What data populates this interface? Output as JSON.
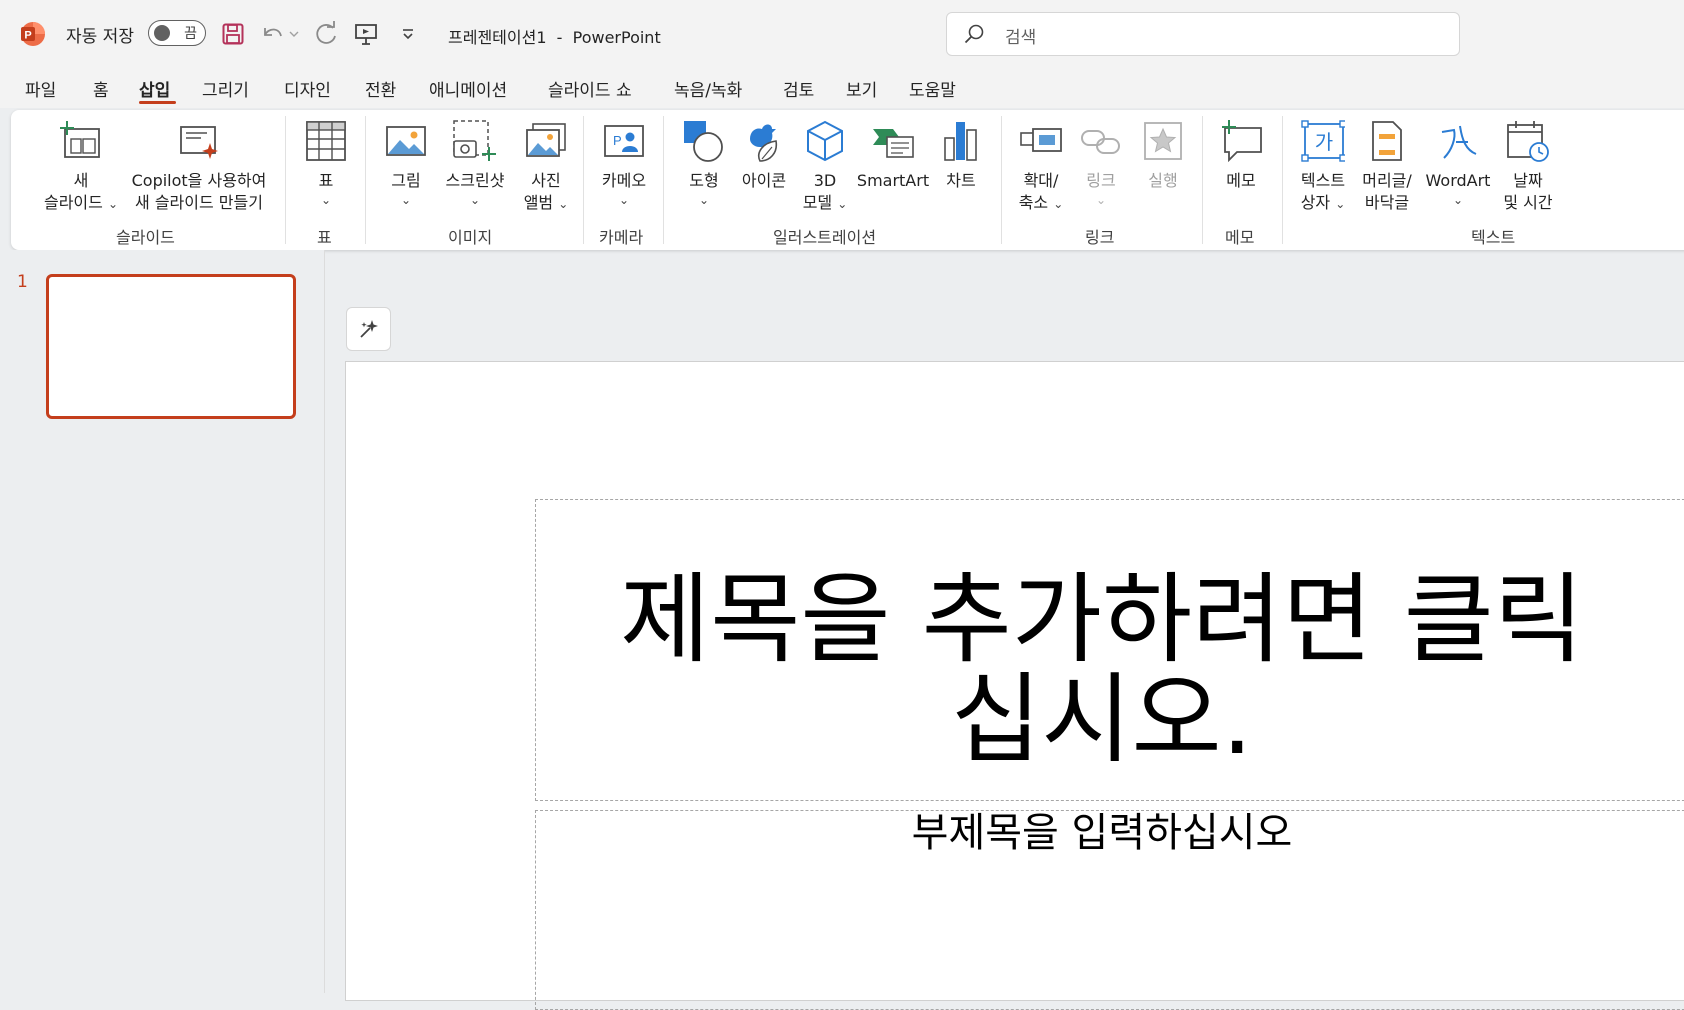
{
  "titlebar": {
    "autosave_label": "자동 저장",
    "autosave_state": "끔",
    "document_title": "프레젠테이션1  -  PowerPoint",
    "search_placeholder": "검색"
  },
  "tabs": [
    "파일",
    "홈",
    "삽입",
    "그리기",
    "디자인",
    "전환",
    "애니메이션",
    "슬라이드 쇼",
    "녹음/녹화",
    "검토",
    "보기",
    "도움말"
  ],
  "active_tab": "삽입",
  "ribbon": {
    "new_slide_1": "새",
    "new_slide_2": "슬라이드",
    "copilot_1": "Copilot을 사용하여",
    "copilot_2": "새 슬라이드 만들기",
    "table": "표",
    "picture": "그림",
    "screenshot": "스크린샷",
    "album_1": "사진",
    "album_2": "앨범",
    "cameo": "카메오",
    "shapes": "도형",
    "icons": "아이콘",
    "model_1": "3D",
    "model_2": "모델",
    "smartart": "SmartArt",
    "chart": "차트",
    "zoom_1": "확대/",
    "zoom_2": "축소",
    "link": "링크",
    "action": "실행",
    "comment": "메모",
    "textbox_1": "텍스트",
    "textbox_2": "상자",
    "header_1": "머리글/",
    "header_2": "바닥글",
    "wordart": "WordArt",
    "datetime_1": "날짜",
    "datetime_2": "및 시간",
    "groups": {
      "slides": "슬라이드",
      "tables": "표",
      "images": "이미지",
      "camera": "카메라",
      "illustrations": "일러스트레이션",
      "links": "링크",
      "comments": "메모",
      "text": "텍스트"
    }
  },
  "slides_pane": {
    "slide_number": "1"
  },
  "slide": {
    "title_line1": "제목을 추가하려면 클릭",
    "title_line2": "십시오.",
    "subtitle": "부제목을 입력하십시오"
  },
  "colors": {
    "accent": "#c43e1c",
    "icon_blue": "#2b7cd3",
    "icon_green": "#2e8b57"
  }
}
